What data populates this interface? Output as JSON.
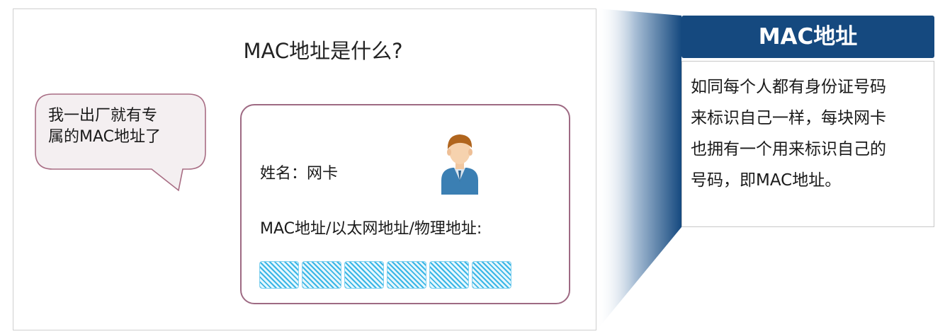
{
  "panel": {
    "title": "MAC地址是什么?"
  },
  "bubble": {
    "line1": "我一出厂就有专",
    "line2": "属的MAC地址了"
  },
  "card": {
    "name_text": "姓名：网卡",
    "mac_label": "MAC地址/以太网地址/物理地址:",
    "mac_block_count": 6,
    "border_color": "#9e6a83",
    "block_color": "#3ab6e6"
  },
  "definition": {
    "title": "MAC地址",
    "lines": [
      "如同每个人都有身份证号码",
      "来标识自己一样，每块网卡",
      "也拥有一个用来标识自己的",
      "号码，即MAC地址。"
    ],
    "header_color": "#15497f"
  },
  "icons": {
    "person": "person-avatar-icon"
  }
}
